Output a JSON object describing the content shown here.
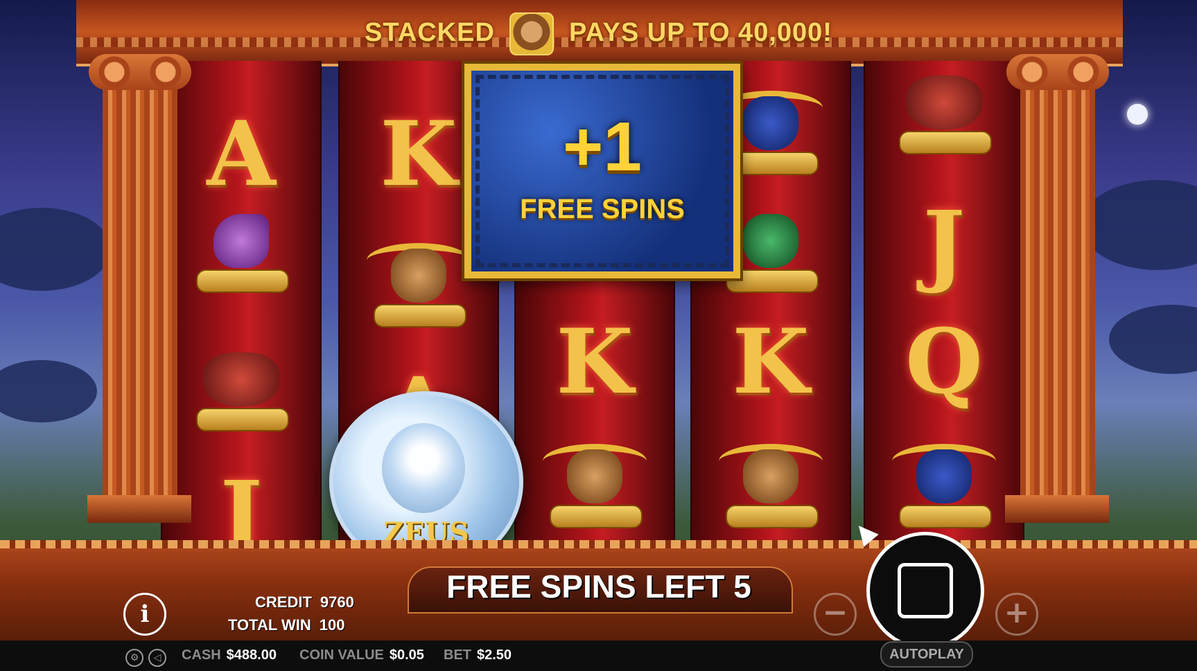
{
  "banner": {
    "left": "STACKED",
    "right": "PAYS UP TO 40,000!"
  },
  "popup": {
    "amount": "+1",
    "label": "FREE SPINS"
  },
  "status": {
    "free_spins_left": "FREE SPINS LEFT 5"
  },
  "reels": [
    [
      "A",
      "eagle",
      "cerberus",
      "J"
    ],
    [
      "K",
      "ram",
      "A",
      "zeus-coin"
    ],
    [
      "popup",
      "ram",
      "K",
      "ram"
    ],
    [
      "bull",
      "boar",
      "K",
      "ram"
    ],
    [
      "cerberus",
      "J",
      "Q",
      "bull"
    ]
  ],
  "zeus_coin": {
    "label": "ZEUS"
  },
  "hud": {
    "credit_label": "CREDIT",
    "credit_value": "9760",
    "total_win_label": "TOTAL WIN",
    "total_win_value": "100",
    "info_label": "i"
  },
  "bottom_bar": {
    "cash_label": "CASH",
    "cash_value": "$488.00",
    "coin_value_label": "COIN VALUE",
    "coin_value_value": "$0.05",
    "bet_label": "BET",
    "bet_value": "$2.50",
    "autoplay_label": "AUTOPLAY"
  },
  "controls": {
    "minus": "−",
    "plus": "+"
  },
  "colors": {
    "gold": "#ffd23a",
    "reel_red": "#c41d22",
    "frame_orange": "#c6561f",
    "popup_blue": "#1a3a8a"
  }
}
